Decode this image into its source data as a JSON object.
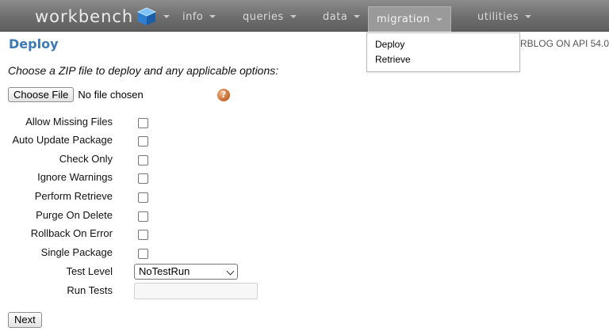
{
  "nav": {
    "brand": "workbench",
    "brand_icon": "cube-icon",
    "menus": [
      "info",
      "queries",
      "data",
      "migration",
      "utilities"
    ],
    "active_menu": "migration"
  },
  "dropdown": {
    "items": [
      "Deploy",
      "Retrieve"
    ]
  },
  "header": {
    "title": "Deploy",
    "api_info": "RBLOG ON API 54.0"
  },
  "form": {
    "instructions": "Choose a ZIP file to deploy and any applicable options:",
    "choose_file_label": "Choose File",
    "file_status": "No file chosen",
    "help_icon": "question-icon",
    "help_glyph": "?",
    "options": [
      {
        "label": "Allow Missing Files",
        "checked": false
      },
      {
        "label": "Auto Update Package",
        "checked": false
      },
      {
        "label": "Check Only",
        "checked": false
      },
      {
        "label": "Ignore Warnings",
        "checked": false
      },
      {
        "label": "Perform Retrieve",
        "checked": false
      },
      {
        "label": "Purge On Delete",
        "checked": false
      },
      {
        "label": "Rollback On Error",
        "checked": false
      },
      {
        "label": "Single Package",
        "checked": false
      }
    ],
    "test_level_label": "Test Level",
    "test_level_value": "NoTestRun",
    "run_tests_label": "Run Tests",
    "run_tests_value": "",
    "next_label": "Next"
  },
  "colors": {
    "title_blue": "#3c78b4",
    "nav_gray": "#6e6e6e"
  }
}
